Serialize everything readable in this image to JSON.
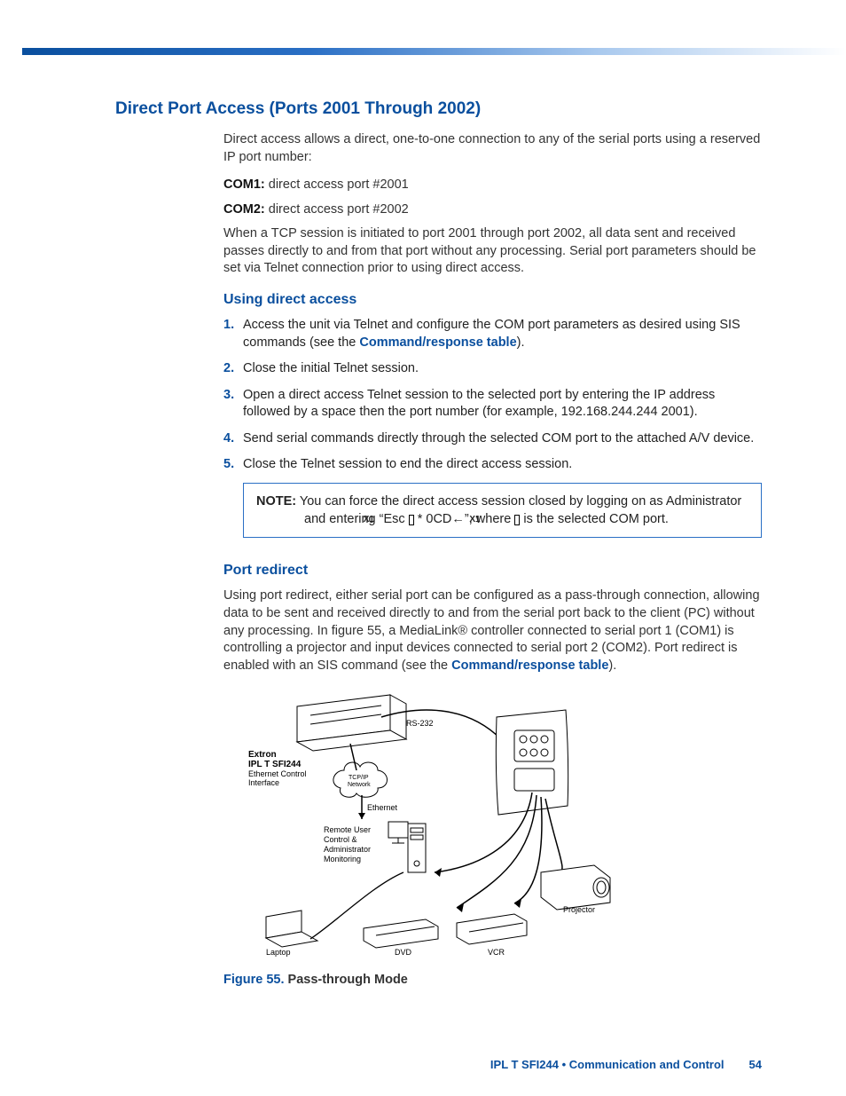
{
  "title": "Direct Port Access (Ports 2001 Through 2002)",
  "intro": "Direct access allows a direct, one-to-one connection to any of the serial ports using a reserved IP port number:",
  "com1_label": "COM1:",
  "com1_text": " direct access port #2001",
  "com2_label": "COM2:",
  "com2_text": " direct access port #2002",
  "tcp_para": "When a TCP session is initiated to port 2001 through port 2002, all data sent and received passes directly to and from that port without any processing.  Serial port parameters should be set via Telnet connection prior to using direct access.",
  "using_heading": "Using direct access",
  "steps": {
    "s1a": "Access the unit via Telnet and configure the COM port parameters as desired using SIS commands (see the ",
    "s1_link": "Command/response table",
    "s1b": ").",
    "s2": "Close the initial Telnet session.",
    "s3": "Open a direct access Telnet session to the selected port by entering the IP address followed by a space then the port number (for example, 192.168.244.244 2001).",
    "s4": "Send serial commands directly through the selected COM port to the attached A/V device.",
    "s5": "Close the Telnet session to end the direct access session."
  },
  "step_nums": {
    "n1": "1.",
    "n2": "2.",
    "n3": "3.",
    "n4": "4.",
    "n5": "5."
  },
  "note": {
    "label": "NOTE:",
    "a": "  You can force the direct access session closed by logging on as Administrator and entering “Esc ",
    "x1": "X1",
    "b": " * 0CD←”, where ",
    "c": " is the selected COM port."
  },
  "port_redirect_heading": "Port redirect",
  "port_redirect_para_a": "Using port redirect, either serial port can be configured as a pass-through connection, allowing data to be sent and received directly to and from the serial port back to the client (PC) without any processing.  In figure 55, a MediaLink® controller connected to serial port 1 (COM1) is controlling a projector and input devices connected to serial port 2 (COM2).  Port redirect is enabled with an SIS command (see the ",
  "port_redirect_link": "Command/response table",
  "port_redirect_para_b": ").",
  "figure": {
    "extron": "Extron",
    "model": "IPL T SFI244",
    "eth_ctrl": "Ethernet Control",
    "iface": "Interface",
    "rs232": "RS-232",
    "tcpip": "TCP/IP",
    "network": "Network",
    "ethernet": "Ethernet",
    "remote1": "Remote User",
    "remote2": "Control &",
    "remote3": "Administrator",
    "remote4": "Monitoring",
    "laptop": "Laptop",
    "dvd": "DVD",
    "vcr": "VCR",
    "projector": "Projector",
    "caption_num": "Figure 55. ",
    "caption_text": "Pass-through Mode"
  },
  "footer": {
    "text": "IPL T SFI244 • Communication and Control",
    "page": "54"
  }
}
